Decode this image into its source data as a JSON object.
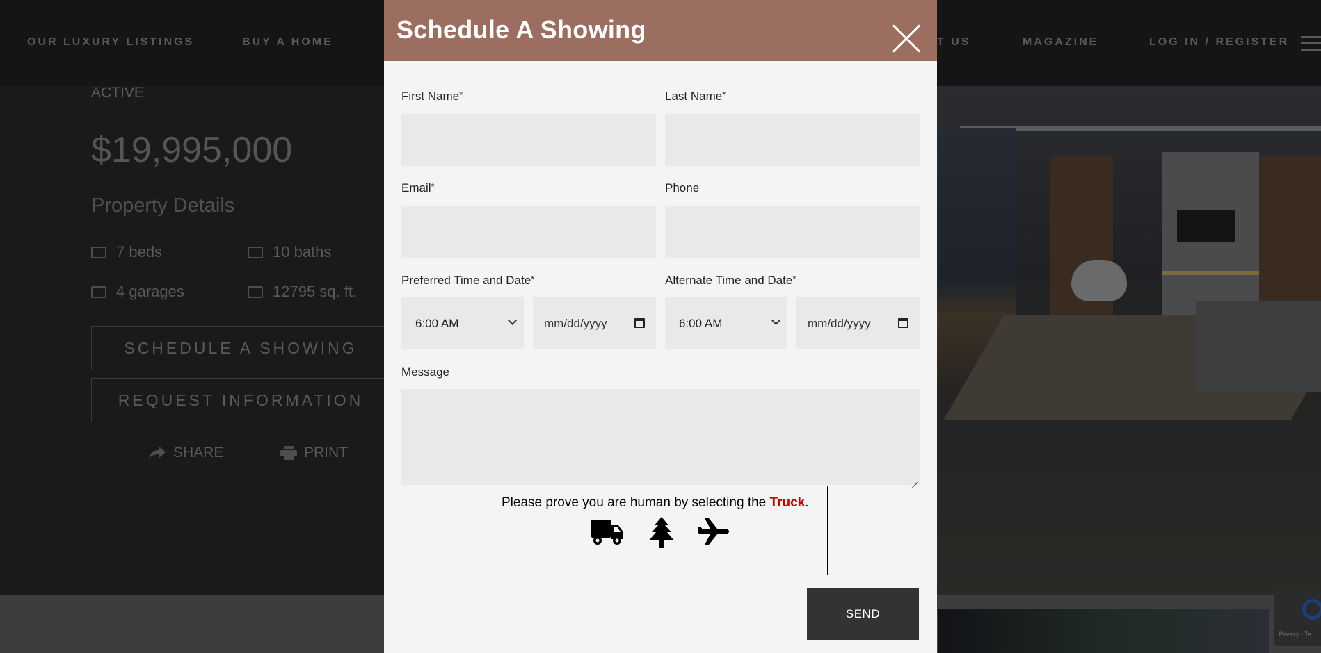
{
  "nav": {
    "items": [
      "OUR LUXURY LISTINGS",
      "BUY A HOME",
      "T US",
      "MAGAZINE",
      "LOG IN / REGISTER"
    ]
  },
  "listing": {
    "status": "ACTIVE",
    "price": "$19,995,000",
    "details_heading": "Property Details",
    "beds": "7 beds",
    "baths": "10 baths",
    "garages": "4 garages",
    "sqft": "12795 sq. ft.",
    "schedule_button": "SCHEDULE A SHOWING",
    "request_button": "REQUEST INFORMATION",
    "share": "SHARE",
    "print": "PRINT"
  },
  "recaptcha": {
    "text": "Privacy - Te"
  },
  "modal": {
    "title": "Schedule A Showing",
    "first_name_label": "First Name",
    "last_name_label": "Last Name",
    "email_label": "Email",
    "phone_label": "Phone",
    "preferred_label": "Preferred Time and Date",
    "alternate_label": "Alternate Time and Date",
    "required_mark": "*",
    "preferred_time": "6:00 AM",
    "preferred_date": "mm/dd/yyyy",
    "alternate_time": "6:00 AM",
    "alternate_date": "mm/dd/yyyy",
    "message_label": "Message",
    "captcha_prefix": "Please prove you are human by selecting the ",
    "captcha_target": "Truck",
    "captcha_suffix": ".",
    "captcha_icons": [
      "truck-icon",
      "tree-icon",
      "plane-icon"
    ],
    "send_label": "SEND"
  },
  "colors": {
    "modal_header": "#9c6e5f",
    "captcha_target": "#cc0000",
    "send_button": "#333333"
  }
}
